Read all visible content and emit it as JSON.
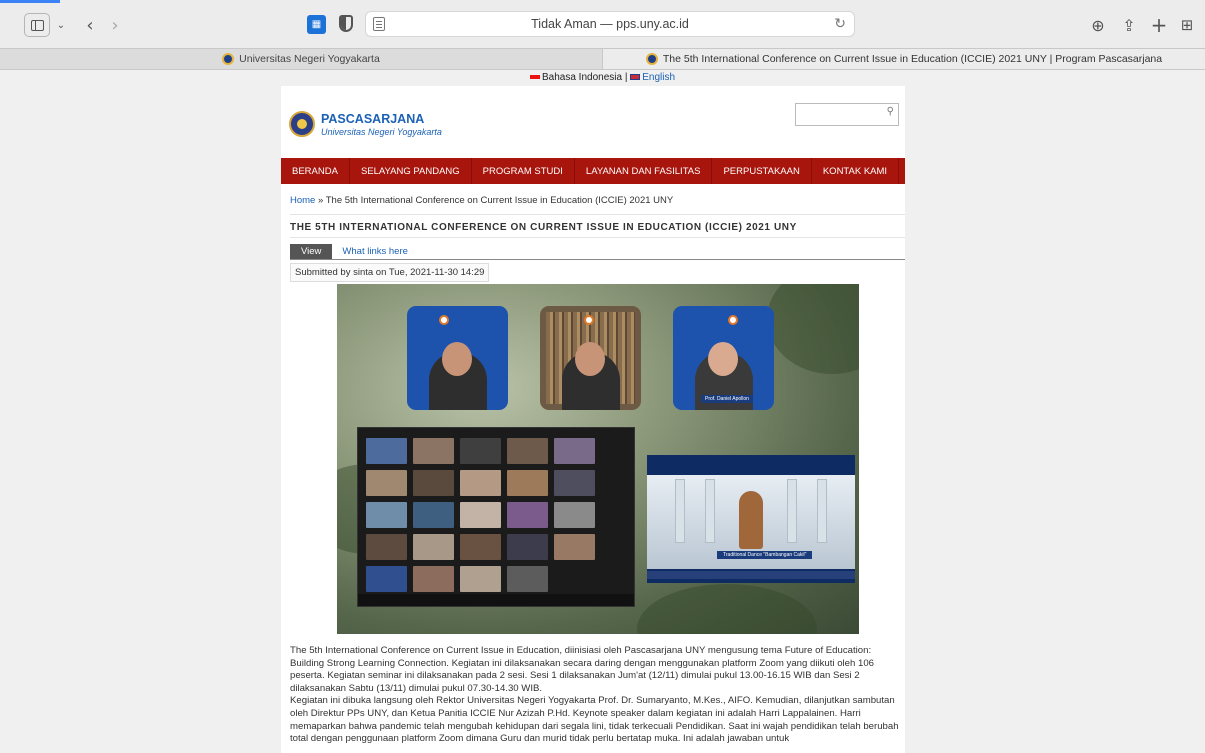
{
  "browser": {
    "address": "Tidak Aman — pps.uny.ac.id",
    "tabs": [
      {
        "title": "Universitas Negeri Yogyakarta",
        "active": false
      },
      {
        "title": "The 5th International Conference on Current Issue in Education (ICCIE) 2021 UNY | Program Pascasarjana",
        "active": true
      }
    ],
    "icons": {
      "sidebar": "sidebar-icon",
      "back": "chevron-left-icon",
      "forward": "chevron-right-icon",
      "extension": "extension-icon",
      "privacy": "shield-icon",
      "reader": "reader-icon",
      "reload": "reload-icon",
      "download": "download-icon",
      "share": "share-icon",
      "new_tab": "plus-icon",
      "tab_overview": "tab-overview-icon"
    }
  },
  "lang": {
    "indonesian": "Bahasa Indonesia",
    "separator": "|",
    "english": "English"
  },
  "site": {
    "name": "PASCASARJANA",
    "slogan": "Universitas Negeri Yogyakarta",
    "colors": {
      "nav": "#a8150d",
      "link": "#1b61b6"
    }
  },
  "nav": [
    "BERANDA",
    "SELAYANG PANDANG",
    "PROGRAM STUDI",
    "LAYANAN DAN FASILITAS",
    "PERPUSTAKAAN",
    "KONTAK KAMI"
  ],
  "breadcrumb": {
    "home": "Home",
    "sep": "»",
    "current": "The 5th International Conference on Current Issue in Education (ICCIE) 2021 UNY"
  },
  "node": {
    "title": "THE 5TH INTERNATIONAL CONFERENCE ON CURRENT ISSUE IN EDUCATION (ICCIE) 2021 UNY",
    "tabs": {
      "view": "View",
      "links": "What links here"
    },
    "submitted": "Submitted by sinta on Tue, 2021-11-30 14:29"
  },
  "photo": {
    "speaker_right_name": "Prof. Daniel Apollon",
    "stage_caption": "Traditional Dance \"Bambangan Cakil\""
  },
  "body": {
    "p1": "The 5th International Conference on Current Issue in Education, diinisiasi oleh Pascasarjana UNY mengusung tema Future of Education: Building Strong Learning Connection. Kegiatan ini dilaksanakan secara daring dengan menggunakan platform Zoom yang diikuti oleh 106 peserta. Kegiatan seminar ini dilaksanakan pada 2 sesi. Sesi 1 dilaksanakan Jum'at (12/11) dimulai pukul 13.00-16.15 WIB dan Sesi 2 dilaksanakan Sabtu (13/11) dimulai pukul 07.30-14.30 WIB.",
    "p2": "Kegiatan ini dibuka langsung oleh Rektor Universitas Negeri Yogyakarta Prof. Dr. Sumaryanto, M.Kes., AIFO. Kemudian, dilanjutkan sambutan oleh Direktur PPs UNY, dan Ketua Panitia ICCIE Nur Azizah P.Hd. Keynote speaker dalam kegiatan ini adalah Harri Lappalainen. Harri memaparkan bahwa pandemic telah mengubah kehidupan dari segala lini, tidak terkecuali Pendidikan. Saat ini wajah pendidikan telah berubah total dengan penggunaan platform Zoom dimana Guru dan murid tidak perlu bertatap muka. Ini adalah jawaban untuk"
  }
}
